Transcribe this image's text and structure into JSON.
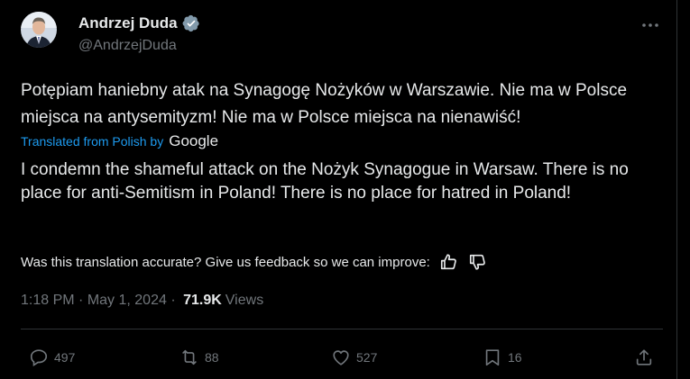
{
  "author": {
    "name": "Andrzej Duda",
    "handle": "@AndrzejDuda"
  },
  "tweet": {
    "text": "Potępiam haniebny atak na Synagogę Nożyków w Warszawie. Nie ma w Polsce miejsca na antysemityzm! Nie ma w Polsce miejsca na nienawiść!",
    "translated_label": "Translated from Polish by",
    "translator": "Google",
    "translation": "I condemn the shameful attack on the Nożyk Synagogue in Warsaw. There is no place for anti-Semitism in Poland! There is no place for hatred in Poland!",
    "feedback_question": "Was this translation accurate? Give us feedback so we can improve:"
  },
  "meta": {
    "time": "1:18 PM",
    "date": "May 1, 2024",
    "views_count": "71.9K",
    "views_label": "Views"
  },
  "actions": {
    "replies": "497",
    "reposts": "88",
    "likes": "527",
    "bookmarks": "16"
  },
  "colors": {
    "background": "#000000",
    "text": "#e7e9ea",
    "secondary": "#71767b",
    "accent": "#1d9bf0",
    "divider": "#2f3336"
  }
}
